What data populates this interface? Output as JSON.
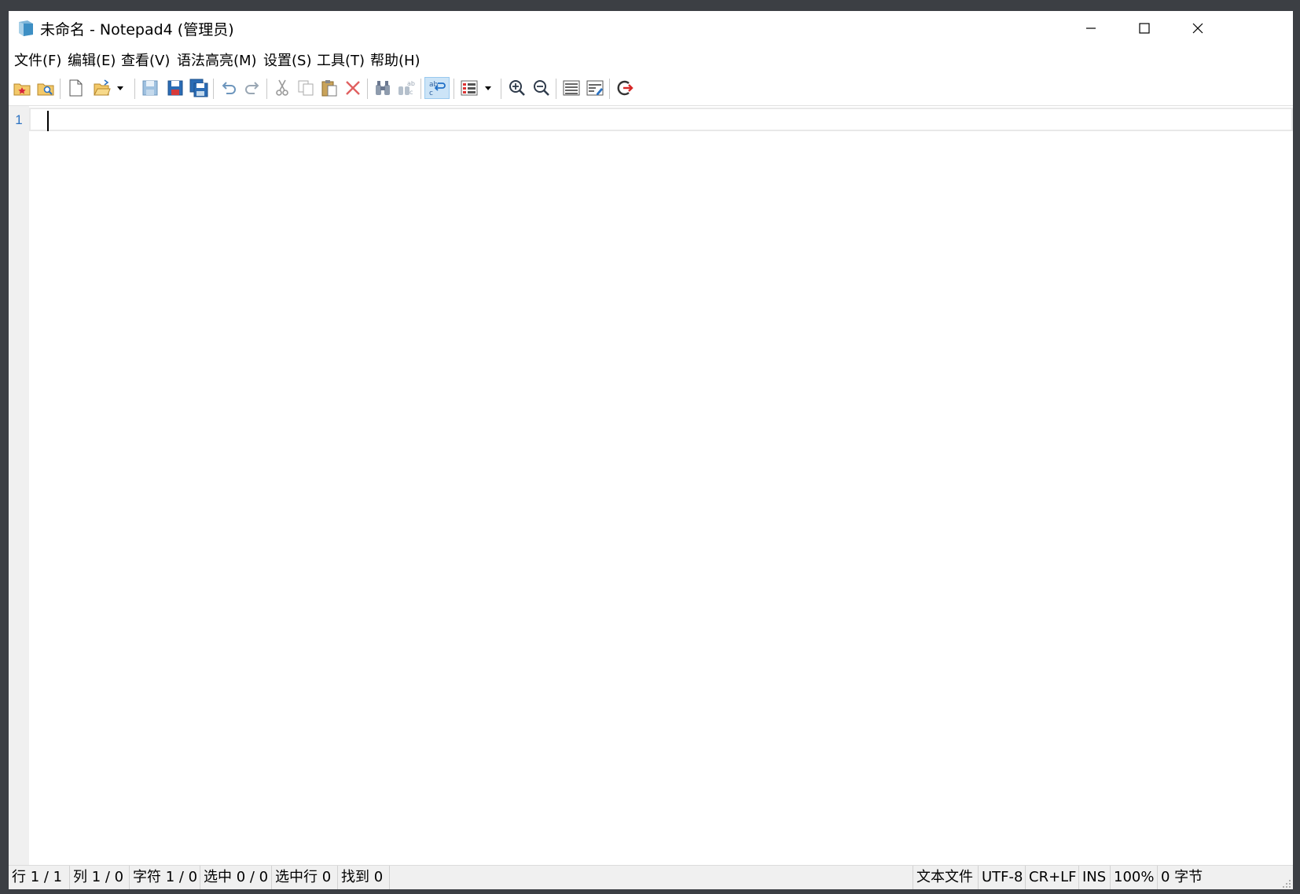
{
  "window": {
    "title": "未命名 - Notepad4 (管理员)",
    "controls": {
      "minimize": "minimize",
      "maximize": "maximize",
      "close": "close"
    }
  },
  "menu": {
    "items": [
      "文件(F)",
      "编辑(E)",
      "查看(V)",
      "语法高亮(M)",
      "设置(S)",
      "工具(T)",
      "帮助(H)"
    ]
  },
  "toolbar": {
    "buttons": [
      {
        "icon": "favorites-icon"
      },
      {
        "icon": "browse-icon"
      },
      {
        "icon": "new-file-icon"
      },
      {
        "icon": "open-folder-icon"
      },
      {
        "icon": "dropdown-arrow-icon"
      },
      {
        "icon": "save-icon"
      },
      {
        "icon": "save-as-icon"
      },
      {
        "icon": "save-all-icon"
      },
      {
        "icon": "undo-icon"
      },
      {
        "icon": "redo-icon"
      },
      {
        "icon": "cut-icon"
      },
      {
        "icon": "copy-icon"
      },
      {
        "icon": "paste-icon"
      },
      {
        "icon": "delete-icon"
      },
      {
        "icon": "find-icon"
      },
      {
        "icon": "replace-icon"
      },
      {
        "icon": "word-wrap-icon",
        "active": true
      },
      {
        "icon": "scheme-icon"
      },
      {
        "icon": "dropdown-arrow-icon"
      },
      {
        "icon": "zoom-in-icon"
      },
      {
        "icon": "zoom-out-icon"
      },
      {
        "icon": "outline-icon"
      },
      {
        "icon": "settings-icon"
      },
      {
        "icon": "exit-icon"
      }
    ]
  },
  "editor": {
    "line_numbers": [
      "1"
    ],
    "content": ""
  },
  "status": {
    "line": "行 1 / 1",
    "column": "列 1 / 0",
    "char": "字符 1 / 0",
    "selection": "选中 0 / 0",
    "selected_lines": "选中行 0",
    "found": "找到 0",
    "file_type": "文本文件",
    "encoding": "UTF-8",
    "line_ending": "CR+LF",
    "insert_mode": "INS",
    "zoom": "100%",
    "size": "0 字节"
  },
  "colors": {
    "accent": "#2b72c2",
    "frame": "#3c3f44",
    "gutter": "#f0f0f0",
    "active_button": "#cce4f7"
  }
}
